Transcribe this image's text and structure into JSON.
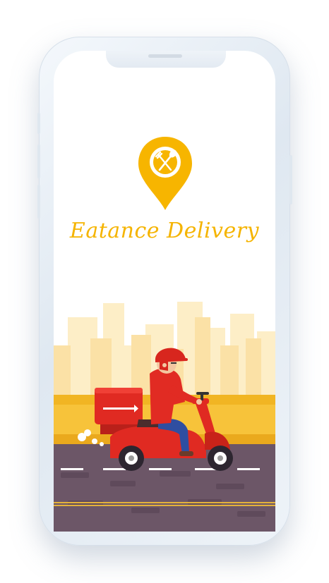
{
  "app": {
    "brand_title": "Eatance Delivery"
  },
  "icons": {
    "logo": "location-pin-fork-spoon-icon",
    "illustration": "scooter-delivery-rider"
  },
  "colors": {
    "brand_yellow": "#f5b400",
    "scooter_red": "#e02a22",
    "road": "#6b5566"
  }
}
